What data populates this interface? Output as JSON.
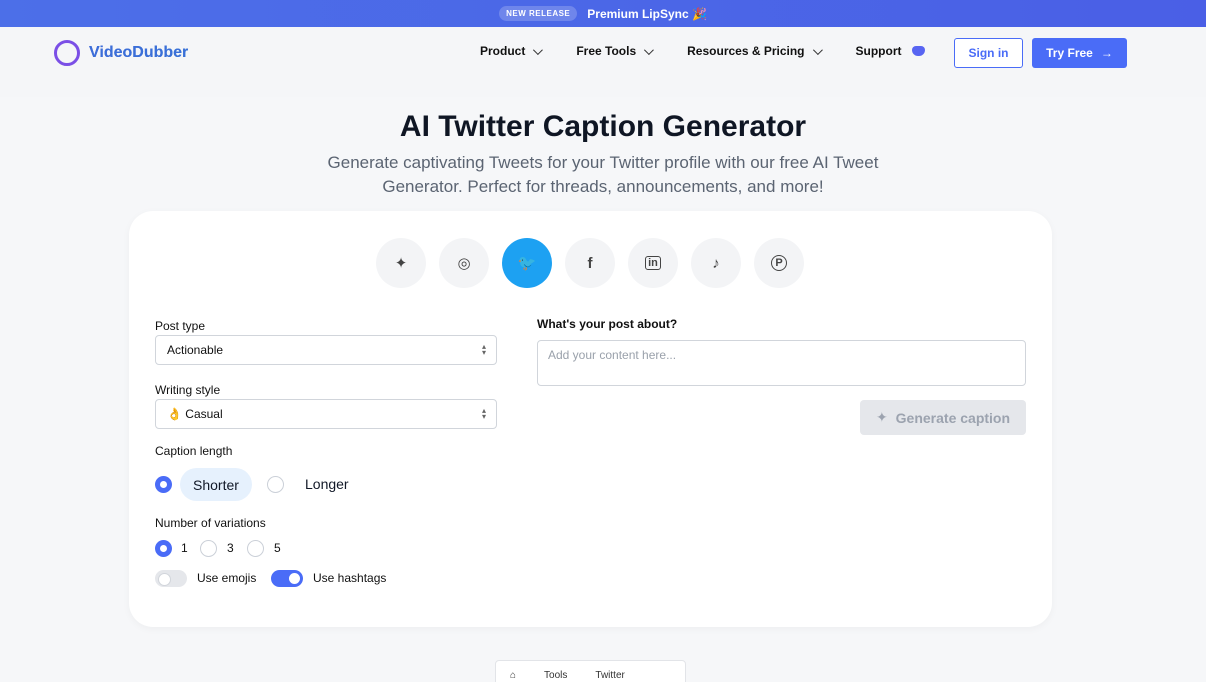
{
  "banner": {
    "badge": "NEW RELEASE",
    "promo": "Premium LipSync 🎉"
  },
  "nav": {
    "logo": "VideoDubber",
    "items": [
      {
        "label": "Product",
        "dropdown": true
      },
      {
        "label": "Free Tools",
        "dropdown": true
      },
      {
        "label": "Resources & Pricing",
        "dropdown": true
      },
      {
        "label": "Support",
        "dropdown": false
      }
    ],
    "signin": "Sign in",
    "tryfree": "Try Free"
  },
  "hero": {
    "title": "AI Twitter Caption Generator",
    "subtitle": "Generate captivating Tweets for your Twitter profile with our free AI Tweet Generator. Perfect for threads, announcements, and more!"
  },
  "platforms": [
    {
      "name": "sparkle",
      "glyph": "✦",
      "active": false
    },
    {
      "name": "instagram",
      "glyph": "◎",
      "active": false
    },
    {
      "name": "twitter",
      "glyph": "🐦",
      "active": true
    },
    {
      "name": "facebook",
      "glyph": "f",
      "active": false
    },
    {
      "name": "linkedin",
      "glyph": "in",
      "active": false
    },
    {
      "name": "tiktok",
      "glyph": "♪",
      "active": false
    },
    {
      "name": "pinterest",
      "glyph": "P",
      "active": false
    }
  ],
  "form": {
    "post_type_label": "Post type",
    "post_type_value": "Actionable",
    "writing_style_label": "Writing style",
    "writing_style_value": "👌 Casual",
    "caption_length_label": "Caption length",
    "length_options": [
      "Shorter",
      "Longer"
    ],
    "length_selected": "Shorter",
    "variations_label": "Number of variations",
    "variation_options": [
      "1",
      "3",
      "5"
    ],
    "variation_selected": "1",
    "use_emojis_label": "Use emojis",
    "use_emojis": false,
    "use_hashtags_label": "Use hashtags",
    "use_hashtags": true,
    "post_about_label": "What's your post about?",
    "post_about_placeholder": "Add your content here...",
    "generate_label": "Generate caption"
  },
  "breadcrumb": {
    "items": [
      "Tools",
      "Twitter"
    ]
  },
  "colors": {
    "accent": "#4a6cf7",
    "twitter": "#1da1f2"
  }
}
